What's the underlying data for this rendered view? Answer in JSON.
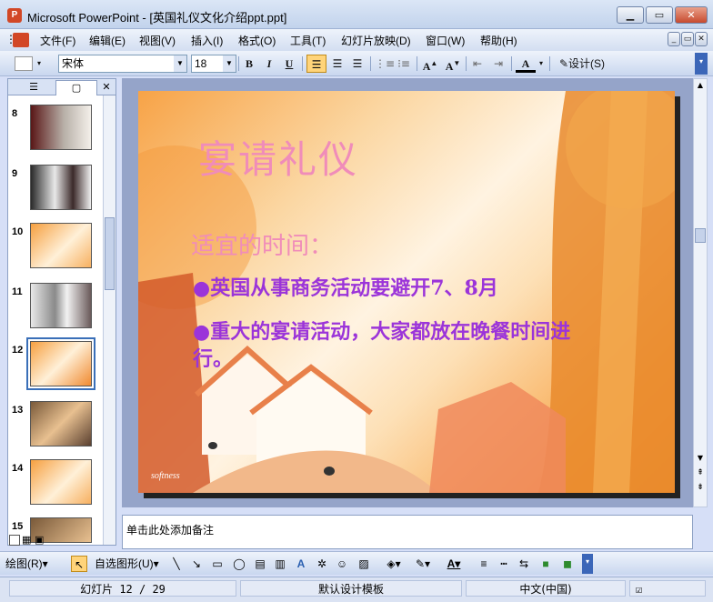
{
  "window": {
    "app_icon": "P",
    "title": "Microsoft PowerPoint - [英国礼仪文化介绍ppt.ppt]"
  },
  "menu": [
    {
      "label": "文件(F)"
    },
    {
      "label": "编辑(E)"
    },
    {
      "label": "视图(V)"
    },
    {
      "label": "插入(I)"
    },
    {
      "label": "格式(O)"
    },
    {
      "label": "工具(T)"
    },
    {
      "label": "幻灯片放映(D)"
    },
    {
      "label": "窗口(W)"
    },
    {
      "label": "帮助(H)"
    }
  ],
  "toolbar": {
    "font_name": "宋体",
    "font_size": "18",
    "bold": "B",
    "italic": "I",
    "underline": "U",
    "design_label": "设计(S)"
  },
  "thumbnails": [
    {
      "num": "8"
    },
    {
      "num": "9"
    },
    {
      "num": "10"
    },
    {
      "num": "11"
    },
    {
      "num": "12"
    },
    {
      "num": "13"
    },
    {
      "num": "14"
    },
    {
      "num": "15"
    }
  ],
  "slide": {
    "title": "宴请礼仪",
    "subtitle": "适宜的时间：",
    "bullet1": "英国从事商务活动要避开7、8月",
    "bullet2_line1": "重大的宴请活动，大家都放在晚餐时间进",
    "bullet2_line2": "行。",
    "watermark": "softness"
  },
  "notes": {
    "placeholder": "单击此处添加备注"
  },
  "drawbar": {
    "draw_label": "绘图(R)",
    "autoshape_label": "自选图形(U)"
  },
  "status": {
    "slide_pos": "幻灯片 12 / 29",
    "template": "默认设计模板",
    "language": "中文(中国)"
  },
  "colors": {
    "title_pink": "#f08cb9",
    "bullet_purple": "#9b34d9"
  }
}
